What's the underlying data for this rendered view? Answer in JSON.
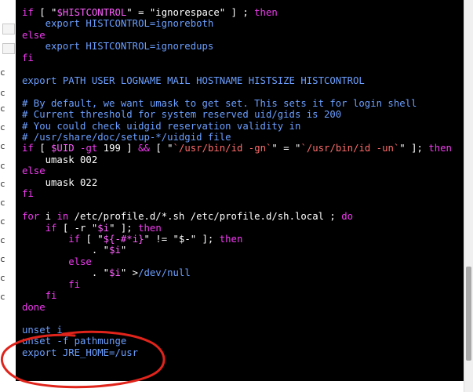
{
  "terminal": {
    "lines": [
      {
        "segments": [
          {
            "t": "if",
            "c": "kw"
          },
          {
            "t": " [ \"",
            "c": "nm"
          },
          {
            "t": "$HISTCONTROL",
            "c": "var"
          },
          {
            "t": "\" = \"ignorespace\" ] ; ",
            "c": "nm"
          },
          {
            "t": "then",
            "c": "kw"
          }
        ]
      },
      {
        "segments": [
          {
            "t": "    export HISTCONTROL=ignoreboth",
            "c": "cm"
          }
        ]
      },
      {
        "segments": [
          {
            "t": "else",
            "c": "kw"
          }
        ]
      },
      {
        "segments": [
          {
            "t": "    export HISTCONTROL=ignoredups",
            "c": "cm"
          }
        ]
      },
      {
        "segments": [
          {
            "t": "fi",
            "c": "kw"
          }
        ]
      },
      {
        "segments": [
          {
            "t": "",
            "c": "nm"
          }
        ]
      },
      {
        "segments": [
          {
            "t": "export PATH USER LOGNAME MAIL HOSTNAME HISTSIZE HISTCONTROL",
            "c": "cm"
          }
        ]
      },
      {
        "segments": [
          {
            "t": "",
            "c": "nm"
          }
        ]
      },
      {
        "segments": [
          {
            "t": "# By default, we want umask to get set. This sets it for login shell",
            "c": "cm"
          }
        ]
      },
      {
        "segments": [
          {
            "t": "# Current threshold for system reserved uid/gids is 200",
            "c": "cm"
          }
        ]
      },
      {
        "segments": [
          {
            "t": "# You could check uidgid reservation validity in",
            "c": "cm"
          }
        ]
      },
      {
        "segments": [
          {
            "t": "# /usr/share/doc/setup-*/uidgid file",
            "c": "cm"
          }
        ]
      },
      {
        "segments": [
          {
            "t": "if",
            "c": "kw"
          },
          {
            "t": " [ ",
            "c": "nm"
          },
          {
            "t": "$UID",
            "c": "var"
          },
          {
            "t": " -gt",
            "c": "kw"
          },
          {
            "t": " 199 ] ",
            "c": "nm"
          },
          {
            "t": "&&",
            "c": "kw"
          },
          {
            "t": " [ \"",
            "c": "nm"
          },
          {
            "t": "`/usr/bin/id -gn`",
            "c": "str"
          },
          {
            "t": "\" = \"",
            "c": "nm"
          },
          {
            "t": "`/usr/bin/id -un`",
            "c": "str"
          },
          {
            "t": "\" ]; ",
            "c": "nm"
          },
          {
            "t": "then",
            "c": "kw"
          }
        ]
      },
      {
        "segments": [
          {
            "t": "    umask 002",
            "c": "nm"
          }
        ]
      },
      {
        "segments": [
          {
            "t": "else",
            "c": "kw"
          }
        ]
      },
      {
        "segments": [
          {
            "t": "    umask 022",
            "c": "nm"
          }
        ]
      },
      {
        "segments": [
          {
            "t": "fi",
            "c": "kw"
          }
        ]
      },
      {
        "segments": [
          {
            "t": "",
            "c": "nm"
          }
        ]
      },
      {
        "segments": [
          {
            "t": "for",
            "c": "kw"
          },
          {
            "t": " i ",
            "c": "nm"
          },
          {
            "t": "in",
            "c": "kw"
          },
          {
            "t": " /etc/profile.d/*.sh /etc/profile.d/sh.local ; ",
            "c": "nm"
          },
          {
            "t": "do",
            "c": "kw"
          }
        ]
      },
      {
        "segments": [
          {
            "t": "    ",
            "c": "nm"
          },
          {
            "t": "if",
            "c": "kw"
          },
          {
            "t": " [ -r \"",
            "c": "nm"
          },
          {
            "t": "$i",
            "c": "var"
          },
          {
            "t": "\" ]; ",
            "c": "nm"
          },
          {
            "t": "then",
            "c": "kw"
          }
        ]
      },
      {
        "segments": [
          {
            "t": "        ",
            "c": "nm"
          },
          {
            "t": "if",
            "c": "kw"
          },
          {
            "t": " [ \"",
            "c": "nm"
          },
          {
            "t": "${-#*i}",
            "c": "var"
          },
          {
            "t": "\" != \"$-\" ]; ",
            "c": "nm"
          },
          {
            "t": "then",
            "c": "kw"
          }
        ]
      },
      {
        "segments": [
          {
            "t": "            . \"",
            "c": "nm"
          },
          {
            "t": "$i",
            "c": "var"
          },
          {
            "t": "\"",
            "c": "nm"
          }
        ]
      },
      {
        "segments": [
          {
            "t": "        else",
            "c": "kw"
          }
        ]
      },
      {
        "segments": [
          {
            "t": "            . \"",
            "c": "nm"
          },
          {
            "t": "$i",
            "c": "var"
          },
          {
            "t": "\" >",
            "c": "nm"
          },
          {
            "t": "/dev/null",
            "c": "cm"
          }
        ]
      },
      {
        "segments": [
          {
            "t": "        fi",
            "c": "kw"
          }
        ]
      },
      {
        "segments": [
          {
            "t": "    fi",
            "c": "kw"
          }
        ]
      },
      {
        "segments": [
          {
            "t": "done",
            "c": "kw"
          }
        ]
      },
      {
        "segments": [
          {
            "t": "",
            "c": "nm"
          }
        ]
      },
      {
        "segments": [
          {
            "t": "unset i",
            "c": "cm"
          }
        ]
      },
      {
        "segments": [
          {
            "t": "unset -f pathmunge",
            "c": "cm"
          }
        ]
      },
      {
        "segments": [
          {
            "t": "export JRE_HOME=/usr",
            "c": "cm"
          }
        ]
      }
    ]
  },
  "left_strip": {
    "marks": [
      "c",
      "c",
      "c",
      "c",
      "c",
      "c",
      "c",
      "c",
      "c",
      "c",
      "c",
      "c",
      "c"
    ]
  },
  "colors": {
    "background": "#000000",
    "keyword": "#f23af2",
    "variable": "#ff5fff",
    "string": "#ff6b6b",
    "command": "#6b9fff",
    "plain": "#ffffff",
    "annotation": "#e0241b"
  }
}
